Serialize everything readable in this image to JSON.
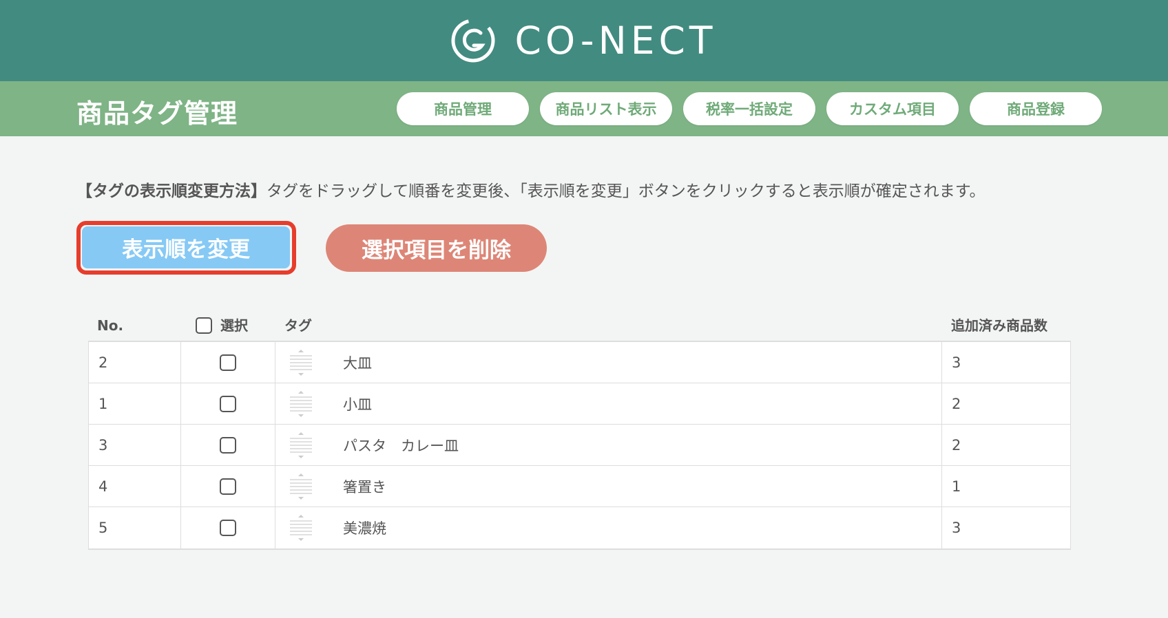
{
  "header": {
    "brand": "CO-NECT",
    "logo_icon": "conect-logo-icon",
    "color": "#428b80"
  },
  "subheader": {
    "title": "商品タグ管理",
    "color": "#7fb486",
    "nav": [
      {
        "label": "商品管理"
      },
      {
        "label": "商品リスト表示"
      },
      {
        "label": "税率一括設定"
      },
      {
        "label": "カスタム項目"
      },
      {
        "label": "商品登録"
      }
    ]
  },
  "instructions": {
    "heading": "【タグの表示順変更方法】",
    "body": "タグをドラッグして順番を変更後、「表示順を変更」ボタンをクリックすると表示順が確定されます。"
  },
  "actions": {
    "reorder_label": "表示順を変更",
    "delete_label": "選択項目を削除",
    "reorder_color": "#86c9f5",
    "delete_color": "#dd8677",
    "highlight_color": "#e63d2c"
  },
  "table": {
    "columns": {
      "no": "No.",
      "select": "選択",
      "tag": "タグ",
      "count": "追加済み商品数"
    },
    "rows": [
      {
        "no": "2",
        "tag": "大皿",
        "count": "3"
      },
      {
        "no": "1",
        "tag": "小皿",
        "count": "2"
      },
      {
        "no": "3",
        "tag": "パスタ　カレー皿",
        "count": "2"
      },
      {
        "no": "4",
        "tag": "箸置き",
        "count": "1"
      },
      {
        "no": "5",
        "tag": "美濃焼",
        "count": "3"
      }
    ]
  }
}
